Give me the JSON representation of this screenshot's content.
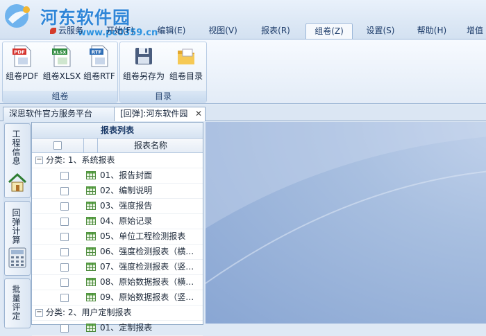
{
  "watermark": {
    "title": "河东软件园",
    "url": "www.pc0359.cn"
  },
  "menu_tabs": [
    {
      "label": "云服务"
    },
    {
      "label": "开始(F)"
    },
    {
      "label": "编辑(E)"
    },
    {
      "label": "视图(V)"
    },
    {
      "label": "报表(R)"
    },
    {
      "label": "组卷(Z)",
      "active": true
    },
    {
      "label": "设置(S)"
    },
    {
      "label": "帮助(H)"
    },
    {
      "label": "增值"
    }
  ],
  "ribbon": {
    "groups": [
      {
        "label": "组卷",
        "buttons": [
          {
            "label": "组卷PDF",
            "icon": "pdf-file-icon",
            "badge": "PDF"
          },
          {
            "label": "组卷XLSX",
            "icon": "xlsx-file-icon",
            "badge": "XLSX"
          },
          {
            "label": "组卷RTF",
            "icon": "rtf-file-icon",
            "badge": "RTF"
          }
        ]
      },
      {
        "label": "目录",
        "buttons": [
          {
            "label": "组卷另存为",
            "icon": "save-disk-icon"
          },
          {
            "label": "组卷目录",
            "icon": "folder-icon"
          }
        ]
      }
    ]
  },
  "doc_tabs": [
    {
      "label": "深思软件官方服务平台"
    },
    {
      "label": "[回弹]:河东软件园",
      "active": true
    }
  ],
  "side_nav": [
    {
      "label": "工程信息",
      "icon": "house-icon"
    },
    {
      "label": "回弹计算",
      "icon": "calculator-icon"
    },
    {
      "label": "批量评定"
    }
  ],
  "report_list": {
    "title": "报表列表",
    "column_name": "报表名称",
    "categories": [
      {
        "label": "分类: 1、系统报表",
        "items": [
          "01、报告封面",
          "02、编制说明",
          "03、强度报告",
          "04、原始记录",
          "05、单位工程检测报表",
          "06、强度检测报表（横…",
          "07、强度检测报表（竖…",
          "08、原始数据报表（横…",
          "09、原始数据报表（竖…"
        ]
      },
      {
        "label": "分类: 2、用户定制报表",
        "items": [
          "01、定制报表"
        ]
      }
    ]
  },
  "colors": {
    "accent": "#2f86d8",
    "tab_text": "#1b3a68",
    "canvas": "#a8bfe0"
  }
}
